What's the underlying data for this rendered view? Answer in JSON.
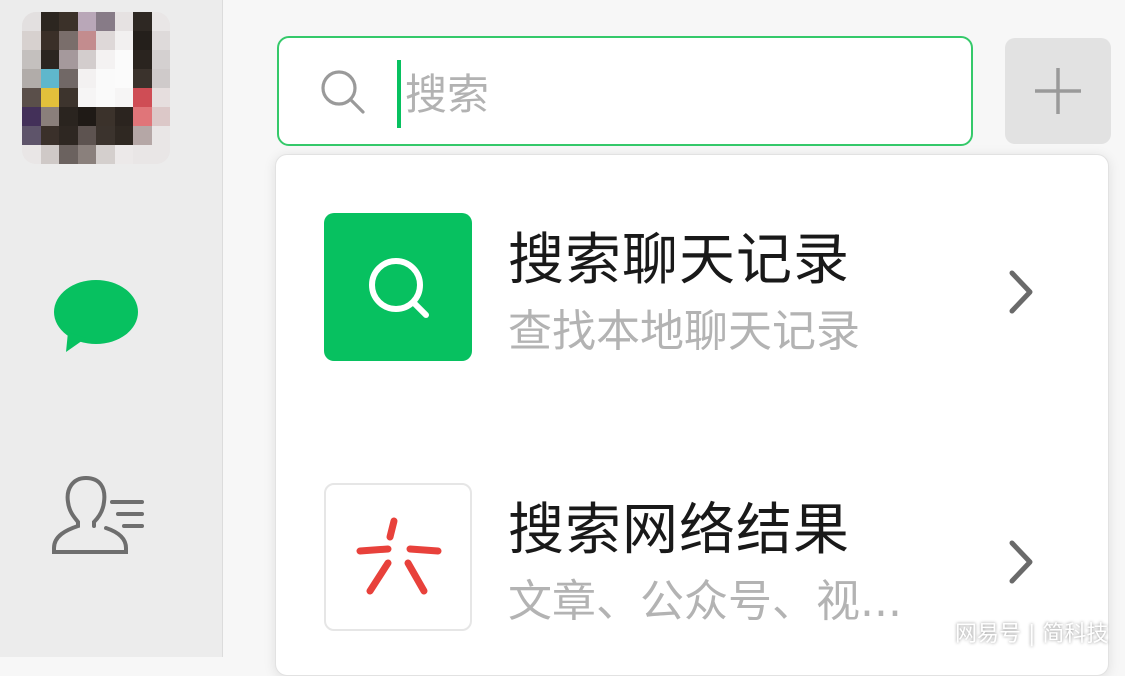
{
  "search": {
    "placeholder": "搜索"
  },
  "results": [
    {
      "title": "搜索聊天记录",
      "subtitle": "查找本地聊天记录",
      "icon": "chat-search-icon"
    },
    {
      "title": "搜索网络结果",
      "subtitle": "文章、公众号、视...",
      "icon": "web-search-logo-icon"
    }
  ],
  "watermark": "网易号 | 简科技",
  "colors": {
    "accent": "#07c160",
    "search_border": "#35c96a",
    "sidebar_bg": "#ececec",
    "logo_red": "#e8413b"
  }
}
